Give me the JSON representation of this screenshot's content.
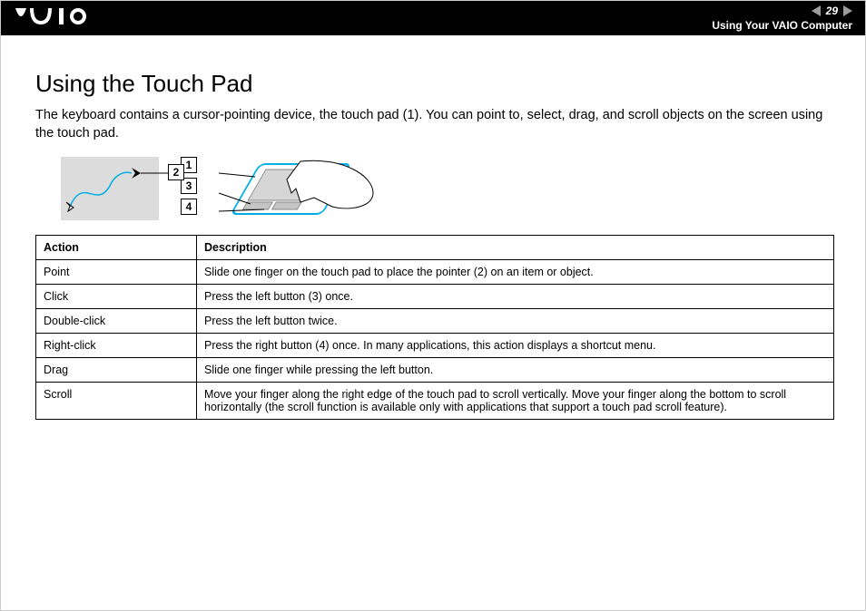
{
  "header": {
    "page": "29",
    "section": "Using Your VAIO Computer"
  },
  "title": "Using the Touch Pad",
  "intro": "The keyboard contains a cursor-pointing device, the touch pad (1). You can point to, select, drag, and scroll objects on the screen using the touch pad.",
  "callouts": {
    "c1": "1",
    "c2": "2",
    "c3": "3",
    "c4": "4"
  },
  "table": {
    "headers": {
      "a": "Action",
      "d": "Description"
    },
    "rows": [
      {
        "a": "Point",
        "d": "Slide one finger on the touch pad to place the pointer (2) on an item or object."
      },
      {
        "a": "Click",
        "d": "Press the left button (3) once."
      },
      {
        "a": "Double-click",
        "d": "Press the left button twice."
      },
      {
        "a": "Right-click",
        "d": "Press the right button (4) once. In many applications, this action displays a shortcut menu."
      },
      {
        "a": "Drag",
        "d": "Slide one finger while pressing the left button."
      },
      {
        "a": "Scroll",
        "d": "Move your finger along the right edge of the touch pad to scroll vertically. Move your finger along the bottom to scroll horizontally (the scroll function is available only with applications that support a touch pad scroll feature)."
      }
    ]
  }
}
